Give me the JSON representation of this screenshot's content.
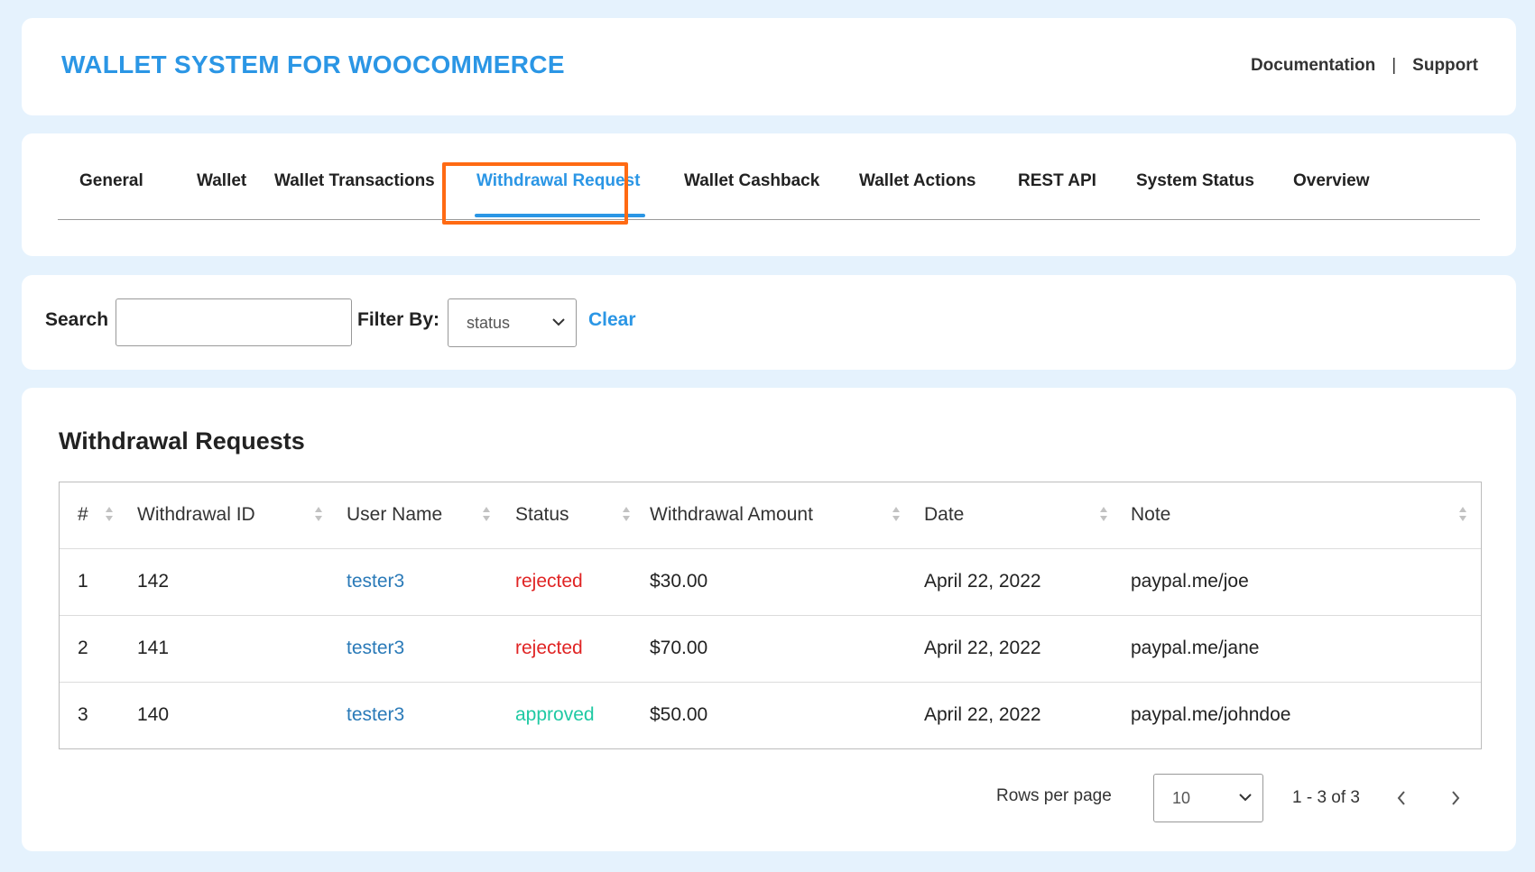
{
  "header": {
    "title": "WALLET SYSTEM FOR WOOCOMMERCE",
    "links": [
      "Documentation",
      "Support"
    ],
    "separator": "|"
  },
  "tabs": [
    {
      "label": "General"
    },
    {
      "label": "Wallet"
    },
    {
      "label": "Wallet Transactions"
    },
    {
      "label": "Withdrawal Request",
      "active": true
    },
    {
      "label": "Wallet Cashback"
    },
    {
      "label": "Wallet Actions"
    },
    {
      "label": "REST API"
    },
    {
      "label": "System Status"
    },
    {
      "label": "Overview"
    }
  ],
  "filters": {
    "search_label": "Search",
    "search_value": "",
    "filter_label": "Filter By:",
    "filter_value": "status",
    "clear_label": "Clear"
  },
  "table": {
    "title": "Withdrawal Requests",
    "columns": [
      "#",
      "Withdrawal ID",
      "User Name",
      "Status",
      "Withdrawal Amount",
      "Date",
      "Note"
    ],
    "rows": [
      {
        "num": "1",
        "id": "142",
        "user": "tester3",
        "status": "rejected",
        "amount": "$30.00",
        "date": "April 22, 2022",
        "note": "paypal.me/joe"
      },
      {
        "num": "2",
        "id": "141",
        "user": "tester3",
        "status": "rejected",
        "amount": "$70.00",
        "date": "April 22, 2022",
        "note": "paypal.me/jane"
      },
      {
        "num": "3",
        "id": "140",
        "user": "tester3",
        "status": "approved",
        "amount": "$50.00",
        "date": "April 22, 2022",
        "note": "paypal.me/johndoe"
      }
    ]
  },
  "pagination": {
    "rows_label": "Rows per page",
    "rows_value": "10",
    "range": "1 - 3 of 3"
  },
  "colors": {
    "accent": "#2b96e5",
    "highlight": "#ff6a13",
    "rejected": "#e02424",
    "approved": "#1fc9a3",
    "page_bg": "#e5f2fd"
  }
}
